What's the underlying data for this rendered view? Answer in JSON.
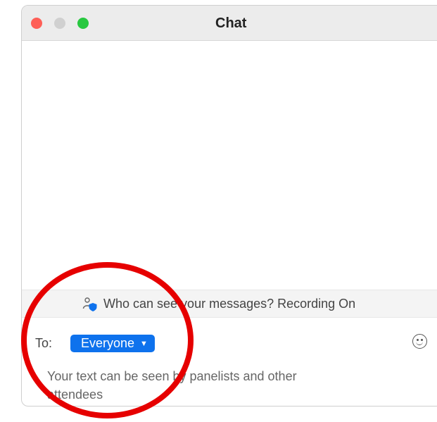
{
  "window": {
    "title": "Chat",
    "controls": {
      "close_color": "#fe5f57",
      "minimize_color": "#d0d0d0",
      "zoom_color": "#28c840"
    }
  },
  "privacy": {
    "icon": "people-shield-icon",
    "text": "Who can see your messages? Recording On"
  },
  "composer": {
    "to_label": "To:",
    "recipient": "Everyone",
    "recipient_color": "#0e72ed",
    "emoji_icon": "smiley-icon",
    "hint": "Your text can be seen by panelists and other attendees"
  },
  "annotation": {
    "color": "#e60000"
  }
}
